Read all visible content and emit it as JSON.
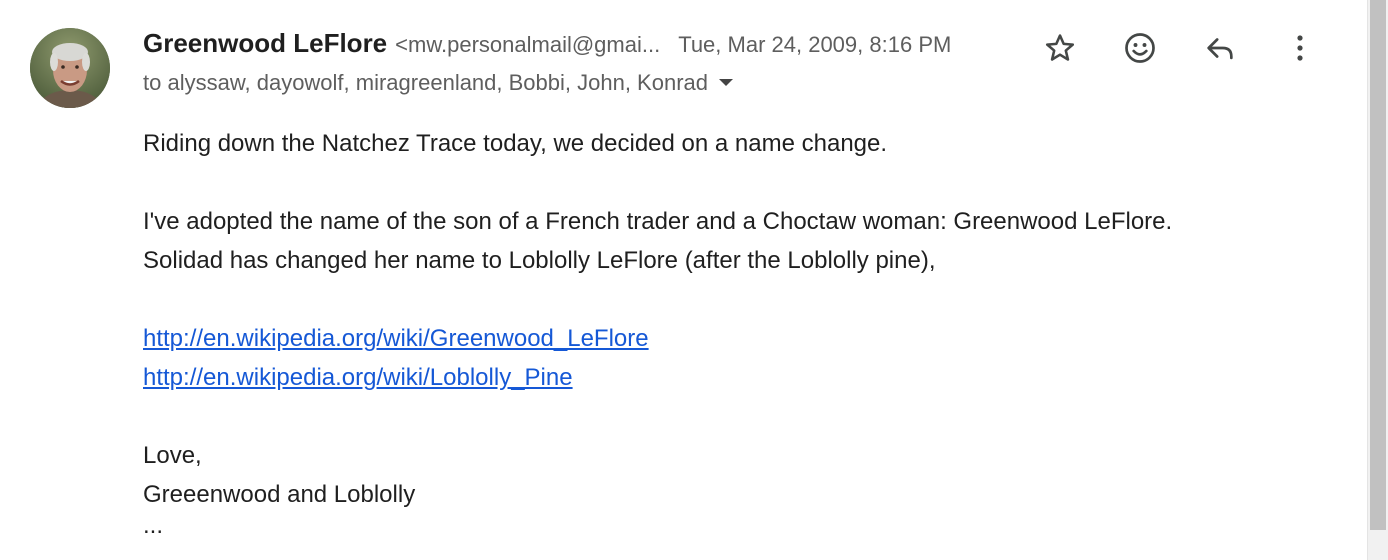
{
  "message": {
    "sender_name": "Greenwood LeFlore",
    "sender_email": "<mw.personalmail@gmai...",
    "date": "Tue, Mar 24, 2009, 8:16 PM",
    "recipients": "to alyssaw, dayowolf, miragreenland, Bobbi, John, Konrad"
  },
  "actions": {
    "star_icon": "star-icon",
    "emoji_icon": "emoji-icon",
    "reply_icon": "reply-icon",
    "more_icon": "more-vert-icon"
  },
  "body": {
    "line1": "Riding down the Natchez Trace today, we decided on a name change.",
    "line2": "I've adopted the name of the  son of a French trader and a Choctaw woman: Greenwood LeFlore.",
    "line3": "Solidad has changed her name to Loblolly LeFlore (after the Loblolly pine),",
    "link1": "http://en.wikipedia.org/wiki/Greenwood_LeFlore",
    "link2": "http://en.wikipedia.org/wiki/Loblolly_Pine",
    "closing": "Love,",
    "signature": "Greeenwood and Loblolly",
    "trimmed": "..."
  },
  "colors": {
    "link": "#1558d6",
    "secondary_text": "#5e5e5e",
    "primary_text": "#1f1f1f"
  }
}
